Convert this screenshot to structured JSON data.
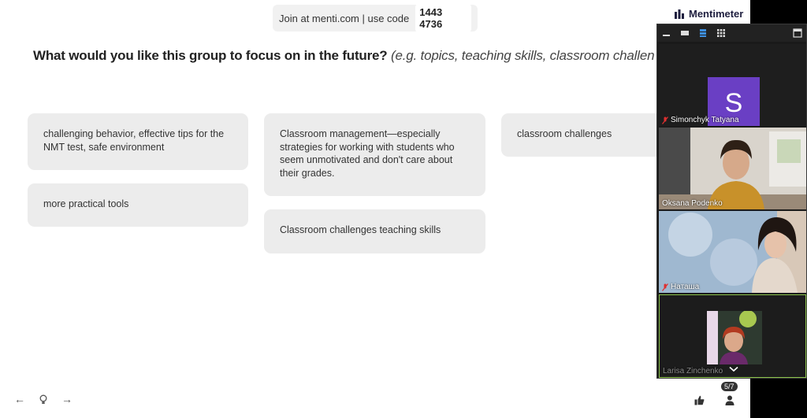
{
  "join_banner": {
    "text": "Join at menti.com | use code",
    "code": "1443 4736"
  },
  "brand": {
    "name": "Mentimeter"
  },
  "question": {
    "title": "What would you like this group to focus on in the future?",
    "hint": "(e.g. topics, teaching skills, classroom challen"
  },
  "responses": [
    "challenging behavior, effective tips for the NMT test, safe environment",
    "more practical tools",
    "Classroom management—especially strategies for working with students who seem unmotivated and don't care about their grades.",
    "Classroom challenges teaching skills",
    "classroom challenges"
  ],
  "nav": {
    "prev": "←",
    "hint": "☉",
    "next": "→"
  },
  "audience": {
    "count": "5/7"
  },
  "participants": [
    {
      "name": "Simonchyk Tatyana",
      "initial": "S",
      "muted": true
    },
    {
      "name": "Oksana Podenko",
      "muted": false
    },
    {
      "name": "Наташа",
      "muted": true
    },
    {
      "name": "Larisa Zinchenko",
      "muted": false
    }
  ],
  "colors": {
    "card_bg": "#ececec",
    "avatar_purple": "#6a3fc4",
    "active_speaker": "#8bc34a"
  }
}
